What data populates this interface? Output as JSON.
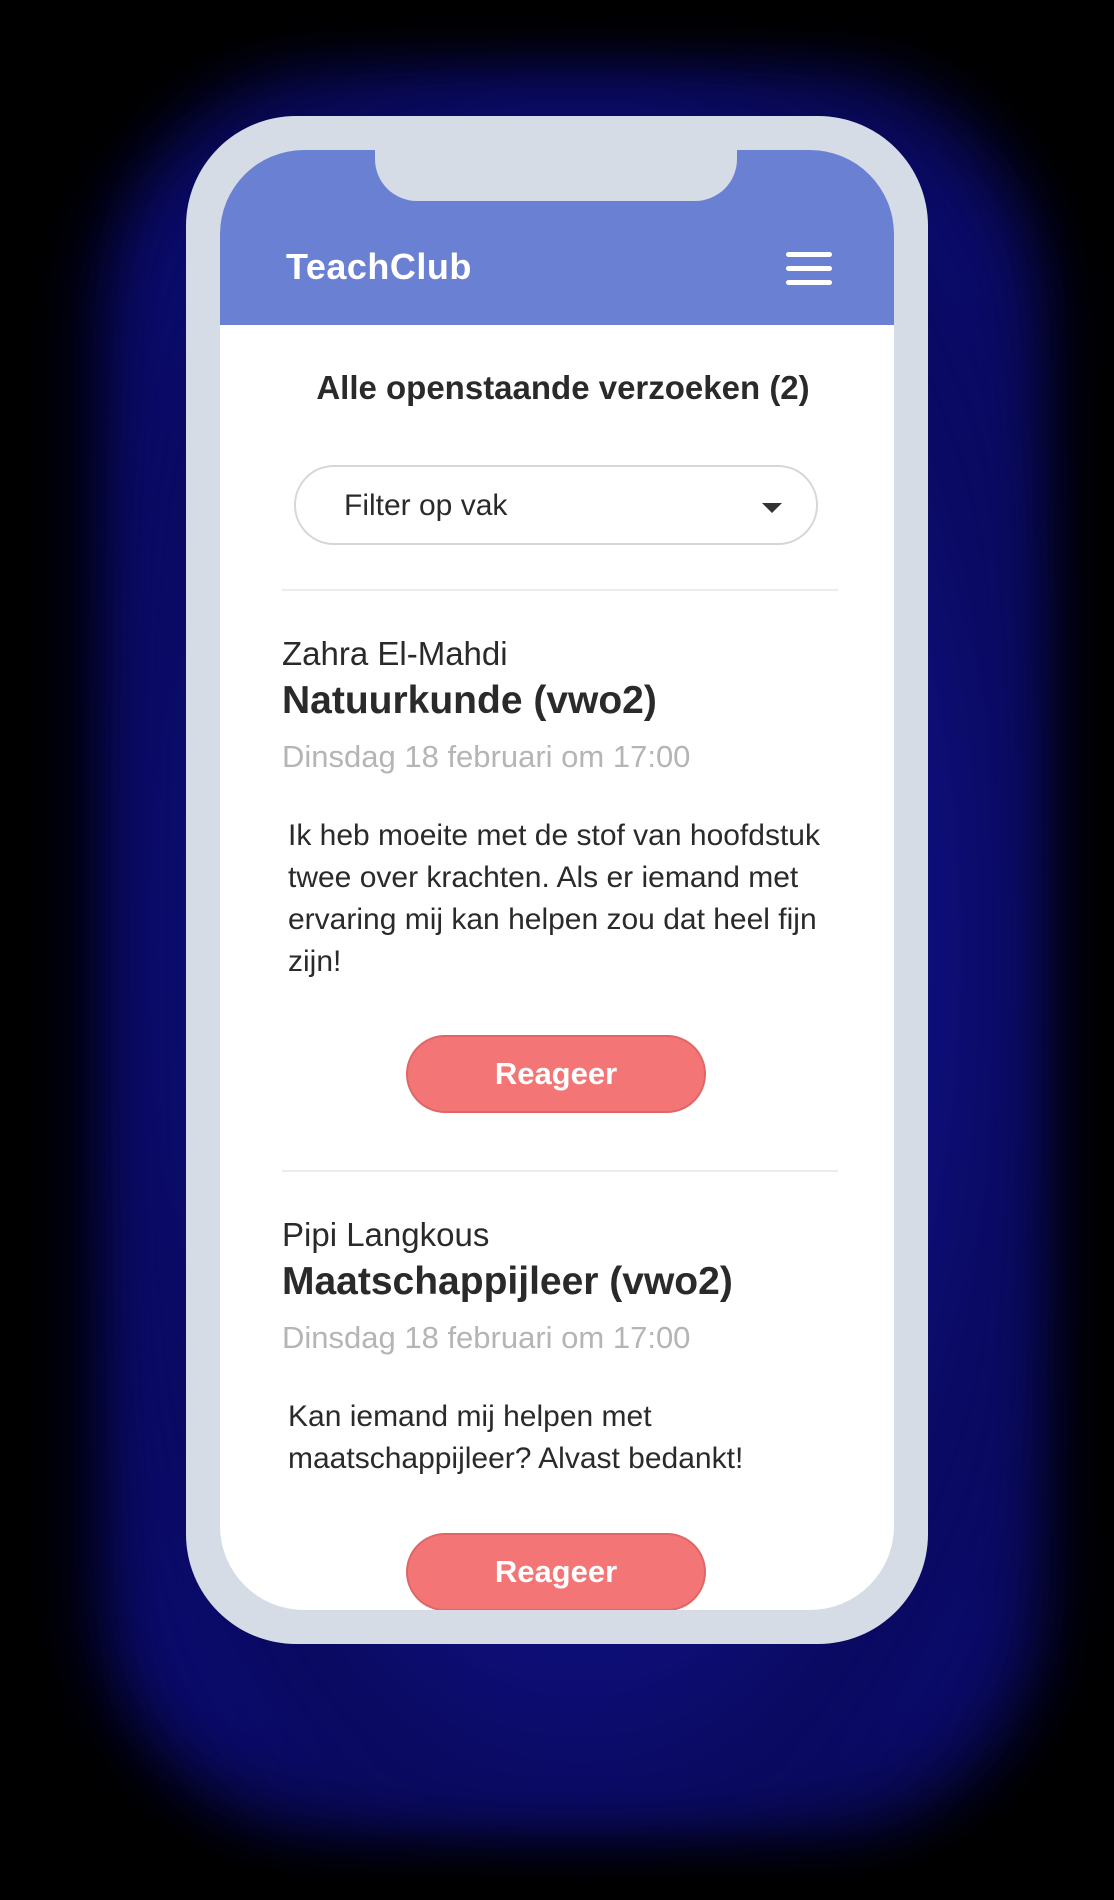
{
  "app": {
    "logo": "TeachClub"
  },
  "page": {
    "title": "Alle openstaande verzoeken (2)"
  },
  "filter": {
    "label": "Filter op vak"
  },
  "requests": [
    {
      "name": "Zahra El-Mahdi",
      "subject": "Natuurkunde (vwo2)",
      "date": "Dinsdag 18 februari om 17:00",
      "message": "Ik heb moeite met de stof van hoofdstuk twee over krachten. Als er iemand met ervaring mij kan helpen zou dat heel fijn zijn!",
      "button": "Reageer"
    },
    {
      "name": "Pipi Langkous",
      "subject": "Maatschappijleer (vwo2)",
      "date": "Dinsdag 18 februari om 17:00",
      "message": "Kan iemand mij helpen met maatschappijleer? Alvast bedankt!",
      "button": "Reageer"
    }
  ],
  "colors": {
    "header": "#6a80d2",
    "button": "#f47575",
    "frame": "#d5dce6",
    "glow": "#1a1aa8"
  },
  "icons": {
    "menu": "hamburger-menu-icon",
    "dropdown": "caret-down-icon"
  }
}
